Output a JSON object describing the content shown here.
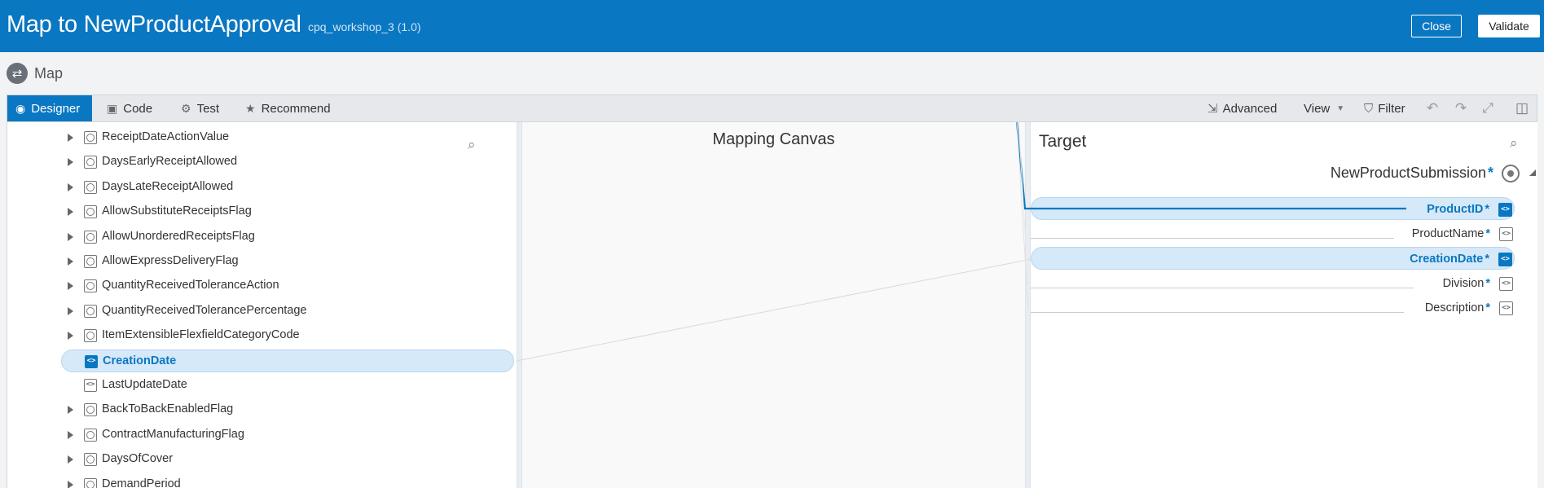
{
  "header": {
    "title": "Map to NewProductApproval",
    "subtitle": "cpq_workshop_3 (1.0)",
    "close_label": "Close",
    "validate_label": "Validate"
  },
  "breadcrumb": {
    "label": "Map"
  },
  "tabs": [
    {
      "label": "Designer",
      "icon": "designer-icon",
      "active": true
    },
    {
      "label": "Code",
      "icon": "code-icon"
    },
    {
      "label": "Test",
      "icon": "gear-icon"
    },
    {
      "label": "Recommend",
      "icon": "star-icon"
    }
  ],
  "toolbar_right": {
    "advanced_label": "Advanced",
    "view_label": "View",
    "filter_label": "Filter"
  },
  "source": {
    "items": [
      {
        "label": "ReceiptDateActionValue",
        "icon": "complex-node-icon",
        "expandable": true
      },
      {
        "label": "DaysEarlyReceiptAllowed",
        "icon": "complex-node-icon",
        "expandable": true
      },
      {
        "label": "DaysLateReceiptAllowed",
        "icon": "complex-node-icon",
        "expandable": true
      },
      {
        "label": "AllowSubstituteReceiptsFlag",
        "icon": "complex-node-icon",
        "expandable": true
      },
      {
        "label": "AllowUnorderedReceiptsFlag",
        "icon": "complex-node-icon",
        "expandable": true
      },
      {
        "label": "AllowExpressDeliveryFlag",
        "icon": "complex-node-icon",
        "expandable": true
      },
      {
        "label": "QuantityReceivedToleranceAction",
        "icon": "complex-node-icon",
        "expandable": true
      },
      {
        "label": "QuantityReceivedTolerancePercentage",
        "icon": "complex-node-icon",
        "expandable": true
      },
      {
        "label": "ItemExtensibleFlexfieldCategoryCode",
        "icon": "complex-node-icon",
        "expandable": true
      },
      {
        "label": "CreationDate",
        "icon": "element-node-icon",
        "expandable": false,
        "selected": true
      },
      {
        "label": "LastUpdateDate",
        "icon": "element-node-icon",
        "expandable": false
      },
      {
        "label": "BackToBackEnabledFlag",
        "icon": "complex-node-icon",
        "expandable": true
      },
      {
        "label": "ContractManufacturingFlag",
        "icon": "complex-node-icon",
        "expandable": true
      },
      {
        "label": "DaysOfCover",
        "icon": "complex-node-icon",
        "expandable": true
      },
      {
        "label": "DemandPeriod",
        "icon": "complex-node-icon",
        "expandable": true
      }
    ]
  },
  "canvas": {
    "title": "Mapping Canvas"
  },
  "target": {
    "title": "Target",
    "root": "NewProductSubmission",
    "required_mark": "*",
    "items": [
      {
        "label": "ProductID",
        "mapped": true
      },
      {
        "label": "ProductName",
        "mapped": false
      },
      {
        "label": "CreationDate",
        "mapped": true
      },
      {
        "label": "Division",
        "mapped": false
      },
      {
        "label": "Description",
        "mapped": false
      }
    ]
  },
  "colors": {
    "brand": "#0a77c2",
    "selected_row": "#d6e9f8"
  }
}
